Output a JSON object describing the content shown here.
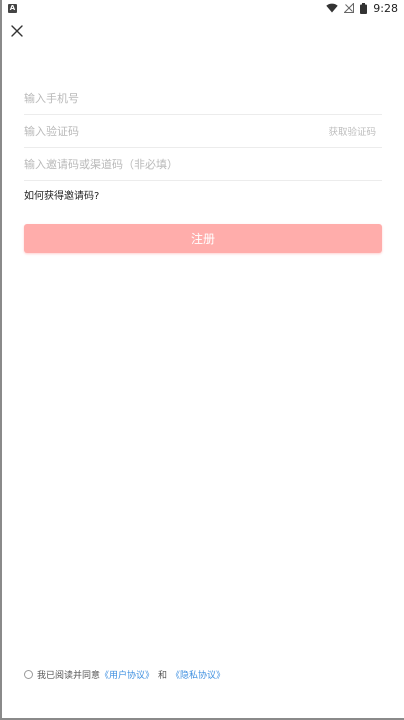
{
  "status_bar": {
    "badge": "A",
    "time": "9:28",
    "icons": [
      "wifi-icon",
      "signal-off-icon",
      "battery-icon"
    ]
  },
  "header": {
    "close_icon": "close-icon"
  },
  "form": {
    "phone_placeholder": "输入手机号",
    "code_placeholder": "输入验证码",
    "get_code_label": "获取验证码",
    "invite_placeholder": "输入邀请码或渠道码（非必填）",
    "invite_help": "如何获得邀请码?"
  },
  "register": {
    "label": "注册",
    "color": "#ffadab"
  },
  "agreement": {
    "prefix": "我已阅读并同意",
    "user_agreement": "《用户协议》",
    "and": "和",
    "privacy_agreement": "《隐私协议》",
    "link_color": "#3d8fe0"
  }
}
